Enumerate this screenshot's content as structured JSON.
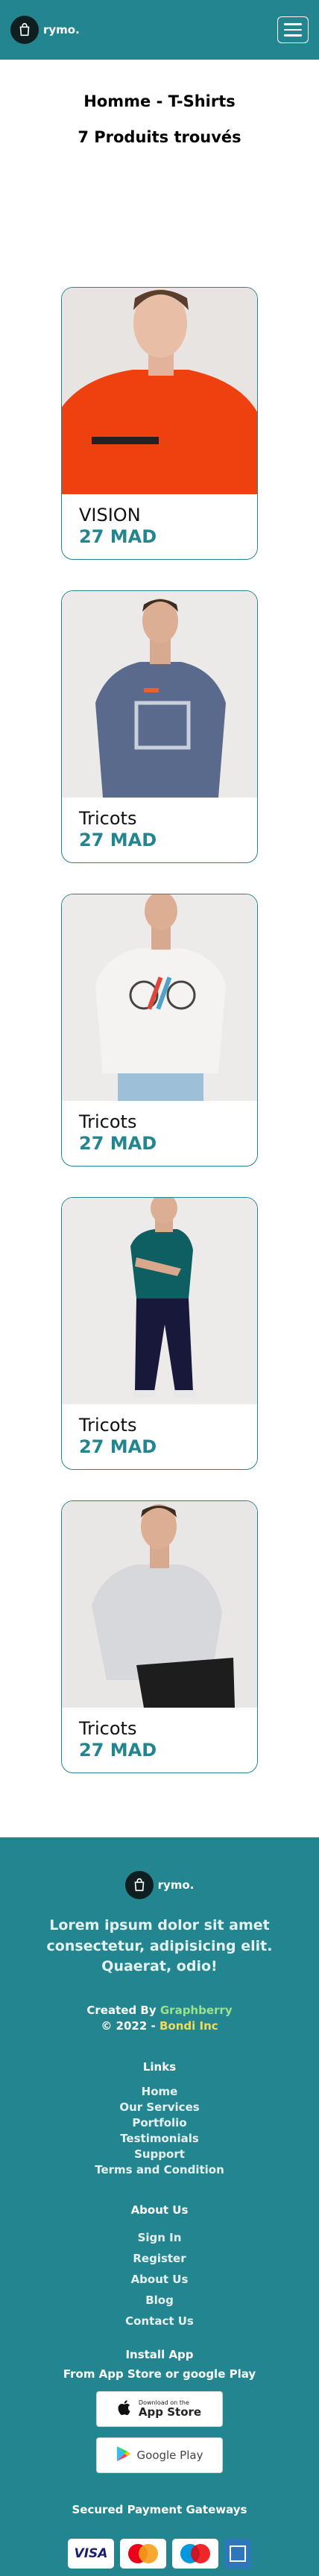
{
  "header": {
    "brand_name": "rymo.",
    "menu_icon": "hamburger-icon",
    "brand_icon": "shopping-bag-icon"
  },
  "page": {
    "title": "Homme - T-Shirts",
    "count_text": "7 Produits trouvés"
  },
  "products": [
    {
      "name": "VISION",
      "price": "27 MAD"
    },
    {
      "name": "Tricots",
      "price": "27 MAD"
    },
    {
      "name": "Tricots",
      "price": "27 MAD"
    },
    {
      "name": "Tricots",
      "price": "27 MAD"
    },
    {
      "name": "Tricots",
      "price": "27 MAD"
    }
  ],
  "footer": {
    "brand_name": "rymo.",
    "tagline": "Lorem ipsum dolor sit amet consectetur, adipisicing elit. Quaerat, odio!",
    "created_by_label": "Created By",
    "created_by_name": "Graphberry",
    "copyright": "© 2022 -",
    "copyright_name": "Bondi Inc",
    "links_title": "Links",
    "links": [
      "Home",
      "Our Services",
      "Portfolio",
      "Testimonials",
      "Support",
      "Terms and Condition"
    ],
    "about_title": "About Us",
    "about_links": [
      "Sign In",
      "Register",
      "About Us",
      "Blog",
      "Contact Us"
    ],
    "install_title": "Install App",
    "install_subtitle": "From App Store or google Play",
    "app_store_small": "Download on the",
    "app_store_big": "App Store",
    "google_play": "Google Play",
    "payments_title": "Secured Payment Gateways",
    "payments": [
      "VISA",
      "MasterCard",
      "Maestro",
      "American Express"
    ]
  },
  "colors": {
    "teal": "#23858f",
    "credit_name": "#9be38a",
    "copyright_name": "#f3dc55"
  }
}
